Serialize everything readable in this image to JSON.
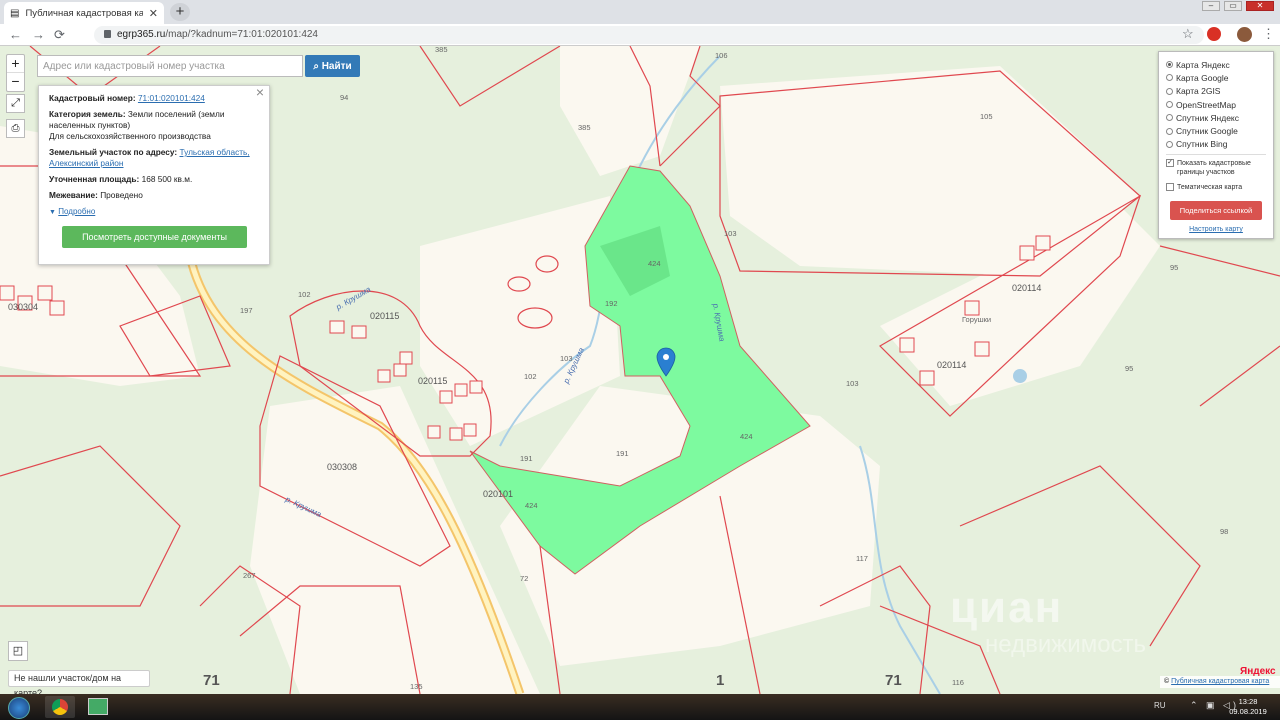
{
  "browser": {
    "tab_title": "Публичная кадастровая карта Т",
    "tab_close": "✕",
    "new_tab": "+",
    "url_host": "egrp365.ru",
    "url_path": "/map/?kadnum=71:01:020101:424",
    "back": "←",
    "forward": "→",
    "reload": "⟳",
    "star": "☆",
    "menu": "⋮"
  },
  "search": {
    "placeholder": "Адрес или кадастровый номер участка",
    "button": "Найти"
  },
  "zoom": {
    "in": "+",
    "out": "−"
  },
  "info": {
    "cadnum_label": "Кадастровый номер:",
    "cadnum_value": "71:01:020101:424",
    "category_label": "Категория земель:",
    "category_value": "Земли поселений (земли населенных пунктов)",
    "category_use": "Для сельскохозяйственного производства",
    "address_label": "Земельный участок по адресу:",
    "address_value": "Тульская область, Алексинский район",
    "area_label": "Уточненная площадь:",
    "area_value": "168 500 кв.м.",
    "survey_label": "Межевание:",
    "survey_value": "Проведено",
    "more": "Подробно",
    "docs_button": "Посмотреть доступные документы",
    "close": "×"
  },
  "layers": {
    "options": [
      "Карта Яндекс",
      "Карта Google",
      "Карта 2GIS",
      "OpenStreetMap",
      "Спутник Яндекс",
      "Спутник Google",
      "Спутник Bing"
    ],
    "selected_index": 0,
    "show_borders": "Показать кадастровые границы участков",
    "show_borders_checked": true,
    "thematic": "Тематическая карта",
    "thematic_checked": false,
    "share_button": "Поделиться ссылкой",
    "setup_link": "Настроить карту"
  },
  "map_labels": {
    "l385a": "385",
    "l385b": "385",
    "l94": "94",
    "l105": "105",
    "l103a": "103",
    "l95a": "95",
    "l95b": "95",
    "q020114": "020114",
    "gorushki": "Горушки",
    "q020114b": "020114",
    "q020115a": "020115",
    "q020115b": "020115",
    "l197": "197",
    "l102a": "102",
    "l102b": "102",
    "river1": "р. Крушма",
    "river2": "р. Крушма",
    "river3": "р. Крушма",
    "river4": "р. Крушма",
    "q030308": "030308",
    "q020101": "020101",
    "l424a": "424",
    "l424b": "424",
    "l424c": "424",
    "l191a": "191",
    "l191b": "191",
    "l103b": "103",
    "l103c": "103",
    "l117": "117",
    "l116": "116",
    "l72": "72",
    "l267": "267",
    "l135": "135",
    "l98": "98",
    "l030304": "030304",
    "l71a": "71",
    "l1": "1",
    "l71b": "71",
    "l192": "192",
    "l106": "106"
  },
  "not_found": "Не нашли участок/дом на карте?",
  "yandex": "Яндекс",
  "public_map": "Публичная кадастровая карта",
  "copyright": "©",
  "watermark": "циан",
  "watermark_sub": "недвижимость",
  "taskbar": {
    "lang": "RU",
    "time": "13:28",
    "date": "09.08.2019"
  },
  "colors": {
    "parcel_fill": "#7dfa9f",
    "boundary": "#e0484f",
    "map_bg": "#e6f0dd",
    "clearing": "#fbf8f0",
    "marker": "#2a7fd1"
  }
}
